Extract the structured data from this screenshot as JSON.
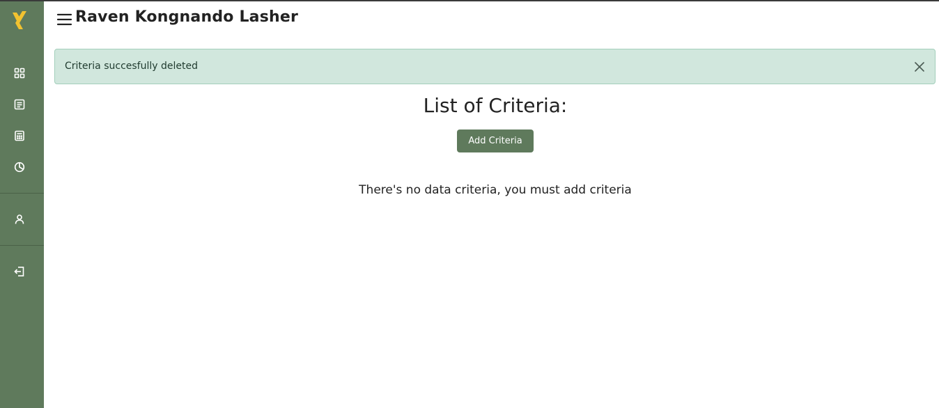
{
  "header": {
    "title": "Raven Kongnando Lasher"
  },
  "alert": {
    "message": "Criteria succesfully deleted"
  },
  "main": {
    "list_title": "List of Criteria:",
    "add_button_label": "Add Criteria",
    "empty_message": "There's no data criteria, you must add criteria"
  },
  "sidebar": {
    "items": [
      {
        "icon": "dashboard-grid-icon"
      },
      {
        "icon": "document-list-icon"
      },
      {
        "icon": "calculator-icon"
      },
      {
        "icon": "pie-chart-icon"
      },
      {
        "icon": "user-icon"
      },
      {
        "icon": "logout-icon"
      }
    ]
  },
  "colors": {
    "sidebar": "#5f7a5c",
    "logo_accent": "#f2c230",
    "alert_bg": "#d1e7dd",
    "button_bg": "#5f7a5c"
  }
}
